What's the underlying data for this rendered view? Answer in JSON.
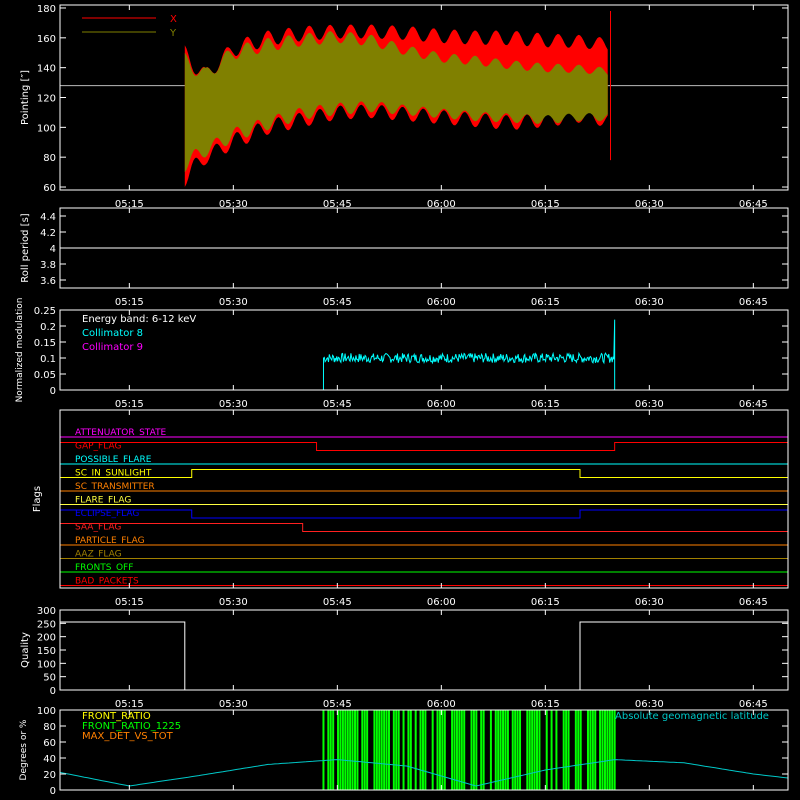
{
  "colors": {
    "background": "#000000",
    "axes": "#ffffff",
    "x_series": "#ff0000",
    "y_series": "#808000",
    "collimator8": "#00ffff",
    "collimator9": "#ff00ff",
    "front_ratio": "#ffff00",
    "front_ratio_1225": "#00ff00",
    "max_det": "#ff8000",
    "geomag": "#00c8c8"
  },
  "time_ticks": [
    "05:15",
    "05:30",
    "05:45",
    "06:00",
    "06:15",
    "06:30",
    "06:45"
  ],
  "chart_data": [
    {
      "id": "pointing",
      "type": "area",
      "ylabel": "Pointing [″]",
      "ylim": [
        58,
        182
      ],
      "yticks": [
        60,
        80,
        100,
        120,
        140,
        160,
        180
      ],
      "xlim_minutes": [
        5.0,
        110.0
      ],
      "reference_line": 128,
      "data_window_minutes": [
        23.0,
        84.5
      ],
      "series": [
        {
          "name": "X",
          "color": "#ff0000",
          "x_minutes": [
            23,
            26,
            30,
            35,
            40,
            45,
            50,
            55,
            60,
            65,
            70,
            75,
            80,
            84
          ],
          "upper": [
            155,
            140,
            158,
            165,
            168,
            169,
            169,
            168,
            166,
            165,
            165,
            163,
            162,
            160
          ],
          "lower": [
            60,
            75,
            85,
            95,
            100,
            105,
            106,
            104,
            102,
            100,
            98,
            100,
            103,
            100
          ]
        },
        {
          "name": "Y",
          "color": "#808000",
          "x_minutes": [
            23,
            26,
            30,
            35,
            40,
            45,
            50,
            55,
            60,
            65,
            70,
            75,
            80,
            84
          ],
          "upper": [
            150,
            140,
            155,
            160,
            163,
            165,
            162,
            155,
            150,
            148,
            145,
            143,
            142,
            140
          ],
          "lower": [
            70,
            80,
            90,
            98,
            105,
            108,
            110,
            108,
            106,
            104,
            103,
            102,
            104,
            104
          ]
        }
      ]
    },
    {
      "id": "roll_period",
      "type": "line",
      "ylabel": "Roll period [s]",
      "ylim": [
        3.5,
        4.5
      ],
      "yticks": [
        3.6,
        3.8,
        4.0,
        4.2,
        4.4
      ],
      "series": [
        {
          "name": "",
          "x_minutes": [
            5,
            110
          ],
          "values": [
            4.0,
            4.0
          ],
          "color": "#ffffff"
        }
      ]
    },
    {
      "id": "modulation",
      "type": "line",
      "ylabel": "Normalized modulation",
      "ylim": [
        0,
        0.25
      ],
      "yticks": [
        0.0,
        0.05,
        0.1,
        0.15,
        0.2,
        0.25
      ],
      "legend": {
        "title": "Energy band: 6-12 keV",
        "items": [
          "Collimator 8",
          "Collimator 9"
        ]
      },
      "series": [
        {
          "name": "Collimator 8",
          "color": "#00ffff",
          "window_minutes": [
            43,
            85
          ],
          "mean": 0.1,
          "spread": 0.015,
          "spike_end": 0.22
        },
        {
          "name": "Collimator 9",
          "color": "#ff00ff",
          "x_minutes": [
            5,
            110
          ],
          "values": [
            0,
            0
          ]
        }
      ]
    },
    {
      "id": "flags",
      "type": "line",
      "ylabel": "Flags",
      "flags": [
        {
          "label": "ATTENUATOR_STATE",
          "color": "#ff00ff",
          "steps": []
        },
        {
          "label": "GAP_FLAG",
          "color": "#ff0000",
          "steps": [
            [
              42,
              85
            ]
          ]
        },
        {
          "label": "POSSIBLE_FLARE",
          "color": "#00ffff",
          "steps": []
        },
        {
          "label": "SC_IN_SUNLIGHT",
          "color": "#ffff00",
          "steps": [
            [
              24,
              80
            ]
          ],
          "step_up": true
        },
        {
          "label": "SC_TRANSMITTER",
          "color": "#ff8000",
          "steps": []
        },
        {
          "label": "FLARE_FLAG",
          "color": "#ffff40",
          "steps": []
        },
        {
          "label": "ECLIPSE_FLAG",
          "color": "#0000ff",
          "steps": [
            [
              24,
              80
            ]
          ]
        },
        {
          "label": "SAA_FLAG",
          "color": "#ff2020",
          "steps": [
            [
              5,
              40
            ]
          ],
          "step_up": true
        },
        {
          "label": "PARTICLE_FLAG",
          "color": "#ff8000",
          "steps": []
        },
        {
          "label": "AAZ_FLAG",
          "color": "#a08000",
          "steps": []
        },
        {
          "label": "FRONTS_OFF",
          "color": "#00ff00",
          "steps": []
        },
        {
          "label": "BAD_PACKETS",
          "color": "#ff0000",
          "steps": []
        }
      ]
    },
    {
      "id": "quality",
      "type": "line",
      "ylabel": "Quality",
      "ylim": [
        0,
        300
      ],
      "yticks": [
        0,
        50,
        100,
        150,
        200,
        250,
        300
      ],
      "series": [
        {
          "name": "",
          "color": "#ffffff",
          "x_minutes": [
            5,
            23,
            23,
            80,
            80,
            110
          ],
          "values": [
            255,
            255,
            0,
            0,
            255,
            255
          ]
        }
      ]
    },
    {
      "id": "front_ratio",
      "type": "line",
      "ylabel": "Degrees or %",
      "ylim": [
        0,
        100
      ],
      "yticks": [
        0,
        20,
        40,
        60,
        80,
        100
      ],
      "legend_items": [
        "FRONT_RATIO",
        "FRONT_RATIO_1225",
        "MAX_DET_VS_TOT"
      ],
      "annotation": "Absolute geomagnetic latitude",
      "series": [
        {
          "name": "FRONT_RATIO_1225",
          "color": "#00ff00",
          "window_minutes": [
            43,
            85
          ],
          "value": 100
        },
        {
          "name": "Absolute geomagnetic latitude",
          "color": "#00c8c8",
          "x_minutes": [
            5,
            15,
            25,
            35,
            45,
            55,
            65,
            75,
            85,
            95,
            105,
            110
          ],
          "values": [
            22,
            5,
            18,
            32,
            38,
            30,
            5,
            25,
            38,
            34,
            20,
            15
          ]
        }
      ]
    }
  ]
}
